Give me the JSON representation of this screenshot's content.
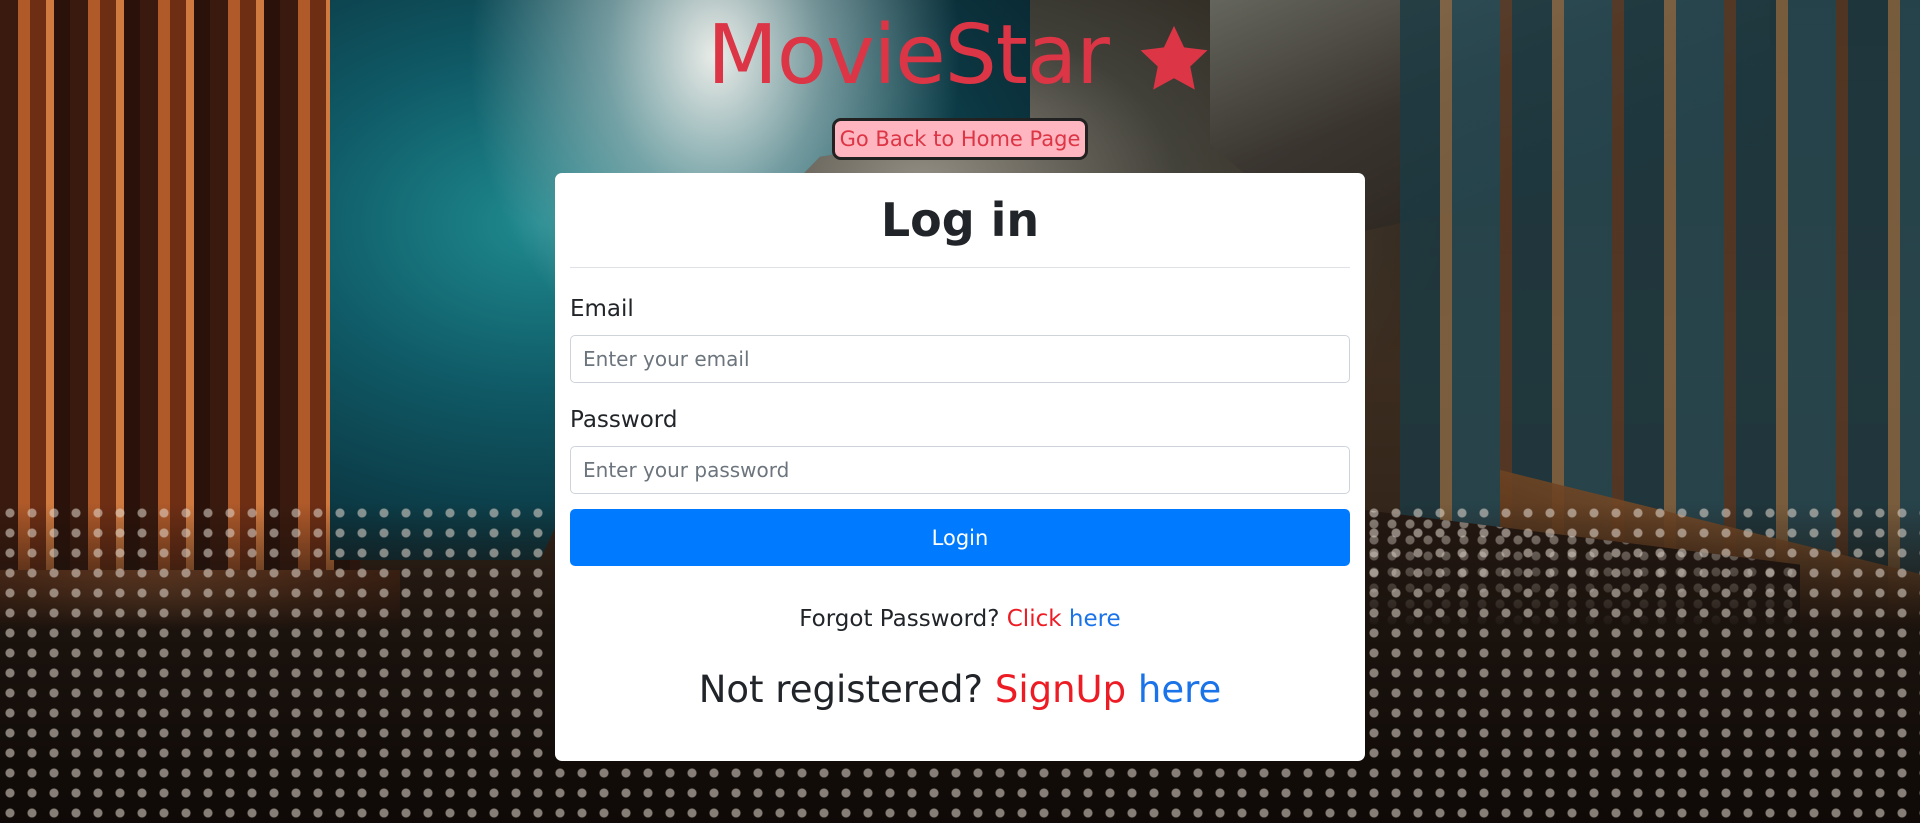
{
  "app": {
    "title": "MovieStar",
    "brand_icon": "star-icon",
    "accent_color": "#dc3545"
  },
  "header": {
    "home_button_label": "Go Back to Home Page"
  },
  "login_card": {
    "title": "Log in",
    "email": {
      "label": "Email",
      "value": "",
      "placeholder": "Enter your email"
    },
    "password": {
      "label": "Password",
      "value": "",
      "placeholder": "Enter your password"
    },
    "submit_label": "Login",
    "forgot": {
      "prefix": "Forgot Password?",
      "click_text": "Click",
      "link_text": "here"
    },
    "register": {
      "prefix": "Not registered?",
      "signup_text": "SignUp",
      "link_text": "here"
    }
  },
  "colors": {
    "primary_button": "#007bff",
    "link_blue": "#1a73e8",
    "link_red": "#ed1c24",
    "home_button_bg": "#ffb6c1"
  }
}
